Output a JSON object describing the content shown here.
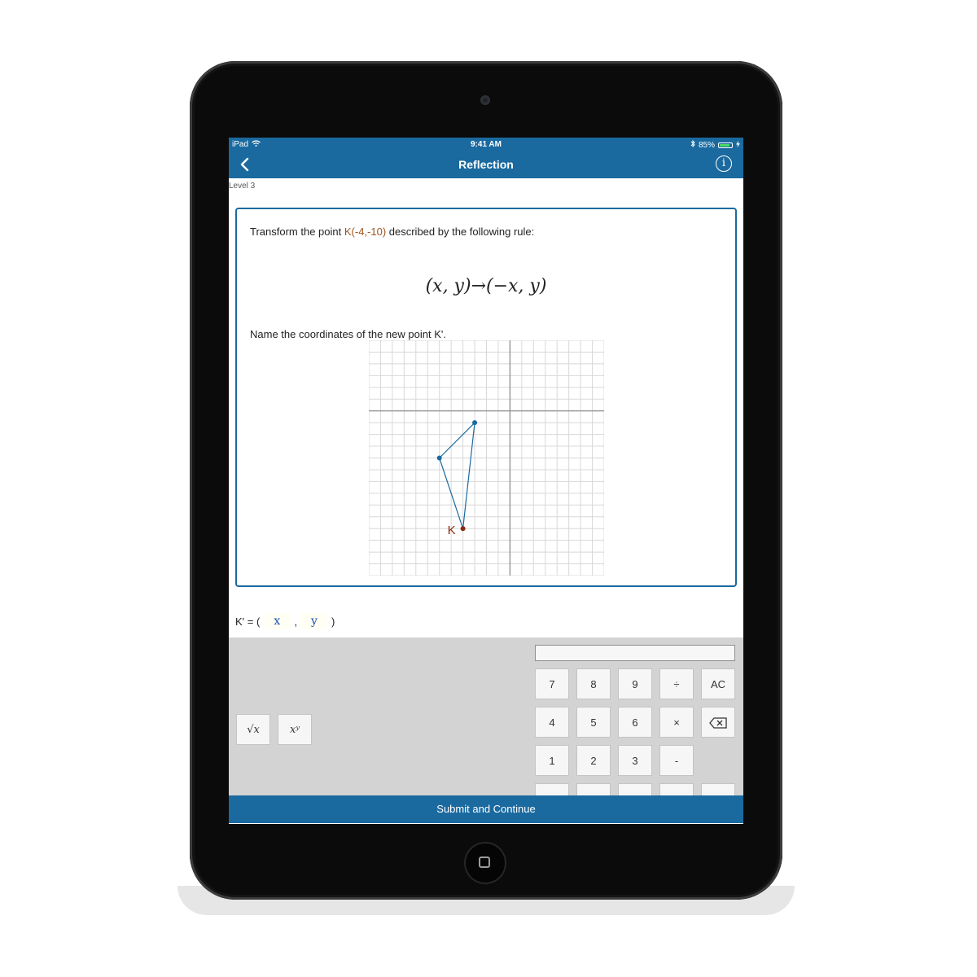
{
  "status_bar": {
    "device": "iPad",
    "time": "9:41 AM",
    "battery": "85%",
    "battery_level": 0.85
  },
  "nav": {
    "title": "Reflection"
  },
  "level": "Level 3",
  "question": {
    "prompt_prefix": "Transform the point ",
    "point": "K(-4,-10)",
    "prompt_suffix": " described by the following rule:",
    "rule": "(x, y)→(−x, y)",
    "name_prompt": "Name the coordinates of the new point K'."
  },
  "graph": {
    "grid": true,
    "xlim": [
      -12,
      8
    ],
    "ylim": [
      -14,
      6
    ],
    "triangle": [
      [
        -3,
        -1
      ],
      [
        -6,
        -4
      ],
      [
        -4,
        -10
      ]
    ],
    "point_label": "K",
    "point_color": "#8b2a10",
    "line_color": "#1a6aa0"
  },
  "answer": {
    "label": "K' = (",
    "comma": ",",
    "close": ")",
    "x_placeholder": "x",
    "y_placeholder": "y"
  },
  "keypad": {
    "func_keys": [
      "√x",
      "xʸ"
    ],
    "rows": [
      [
        "7",
        "8",
        "9",
        "÷",
        "AC"
      ],
      [
        "4",
        "5",
        "6",
        "×",
        "⌫"
      ],
      [
        "1",
        "2",
        "3",
        "-"
      ]
    ]
  },
  "submit_label": "Submit and Continue",
  "colors": {
    "accent": "#1a6aa0",
    "point_label": "#a0521d"
  }
}
